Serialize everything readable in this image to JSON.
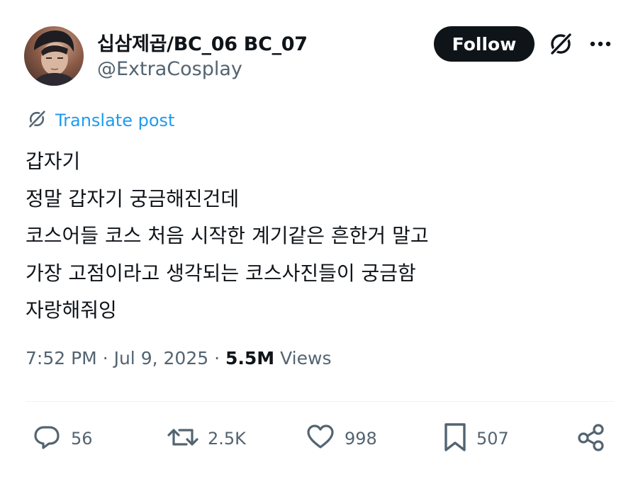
{
  "author": {
    "display_name": "십삼제곱/BC_06 BC_07",
    "handle": "@ExtraCosplay"
  },
  "header": {
    "follow_label": "Follow",
    "grok_icon": "grok-icon",
    "more_icon": "more-dots-icon"
  },
  "translate": {
    "label": "Translate post",
    "icon": "grok-icon"
  },
  "post": {
    "lines": [
      "갑자기",
      "정말 갑자기 궁금해진건데",
      "코스어들 코스 처음 시작한 계기같은 흔한거 말고",
      "가장 고점이라고 생각되는 코스사진들이 궁금함",
      "자랑해줘잉"
    ]
  },
  "meta": {
    "time": "7:52 PM",
    "separator": "·",
    "date": "Jul 9, 2025",
    "views_count": "5.5M",
    "views_label": "Views"
  },
  "actions": {
    "reply": {
      "icon": "reply-icon",
      "count": "56"
    },
    "repost": {
      "icon": "repost-icon",
      "count": "2.5K"
    },
    "like": {
      "icon": "heart-icon",
      "count": "998"
    },
    "bookmark": {
      "icon": "bookmark-icon",
      "count": "507"
    },
    "share": {
      "icon": "share-icon"
    }
  },
  "colors": {
    "text": "#0f1419",
    "secondary": "#536471",
    "link": "#1d9bf0",
    "follow_bg": "#0f1419",
    "divider": "#eff3f4"
  }
}
